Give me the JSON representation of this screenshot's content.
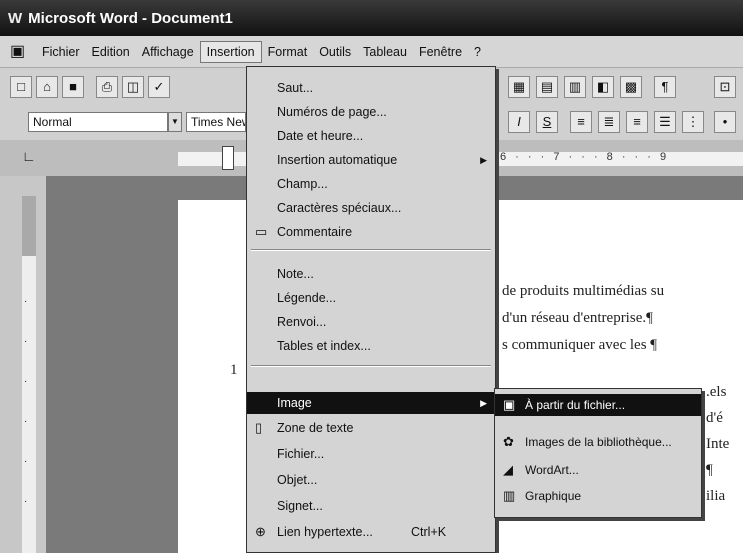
{
  "window": {
    "title": "Microsoft Word - Document1",
    "app_icon": "W"
  },
  "menubar": {
    "items": [
      "Fichier",
      "Edition",
      "Affichage",
      "Insertion",
      "Format",
      "Outils",
      "Tableau",
      "Fenêtre",
      "?"
    ],
    "active": "Insertion"
  },
  "toolbar": {
    "style_value": "Normal",
    "font_value": "Times New Roman",
    "format_buttons": [
      "I",
      "S"
    ]
  },
  "ruler": {
    "numbers": "6 · · · 7 · · · 8 · · · 9"
  },
  "document": {
    "lines": [
      "de produits multimédias su",
      "d'un réseau d'entreprise.¶",
      "s communiquer avec les ¶",
      "1",
      ".els",
      "d'é",
      "Inte",
      "¶",
      "ilia"
    ]
  },
  "insertion_menu": {
    "items": [
      {
        "label": "Saut...",
        "icon": ""
      },
      {
        "label": "Numéros de page...",
        "icon": ""
      },
      {
        "label": "Date et heure...",
        "icon": ""
      },
      {
        "label": "Insertion automatique",
        "icon": "",
        "submenu": true
      },
      {
        "label": "Champ...",
        "icon": ""
      },
      {
        "label": "Caractères spéciaux...",
        "icon": ""
      },
      {
        "label": "Commentaire",
        "icon": "comment-icon"
      },
      {
        "label": "Note...",
        "icon": ""
      },
      {
        "label": "Légende...",
        "icon": ""
      },
      {
        "label": "Renvoi...",
        "icon": ""
      },
      {
        "label": "Tables et index...",
        "icon": ""
      },
      {
        "label": "Image",
        "icon": "",
        "submenu": true,
        "highlighted": true
      },
      {
        "label": "Zone de texte",
        "icon": "textbox-icon"
      },
      {
        "label": "Fichier...",
        "icon": ""
      },
      {
        "label": "Objet...",
        "icon": ""
      },
      {
        "label": "Signet...",
        "icon": ""
      },
      {
        "label": "Lien hypertexte...",
        "icon": "hyperlink-icon",
        "shortcut": "Ctrl+K"
      }
    ]
  },
  "image_submenu": {
    "items": [
      {
        "label": "À partir du fichier...",
        "icon": "from-file-icon",
        "highlighted": true
      },
      {
        "label": "Images de la bibliothèque...",
        "icon": "clipart-icon"
      },
      {
        "label": "WordArt...",
        "icon": "wordart-icon"
      },
      {
        "label": "Graphique",
        "icon": "chart-icon"
      }
    ]
  }
}
